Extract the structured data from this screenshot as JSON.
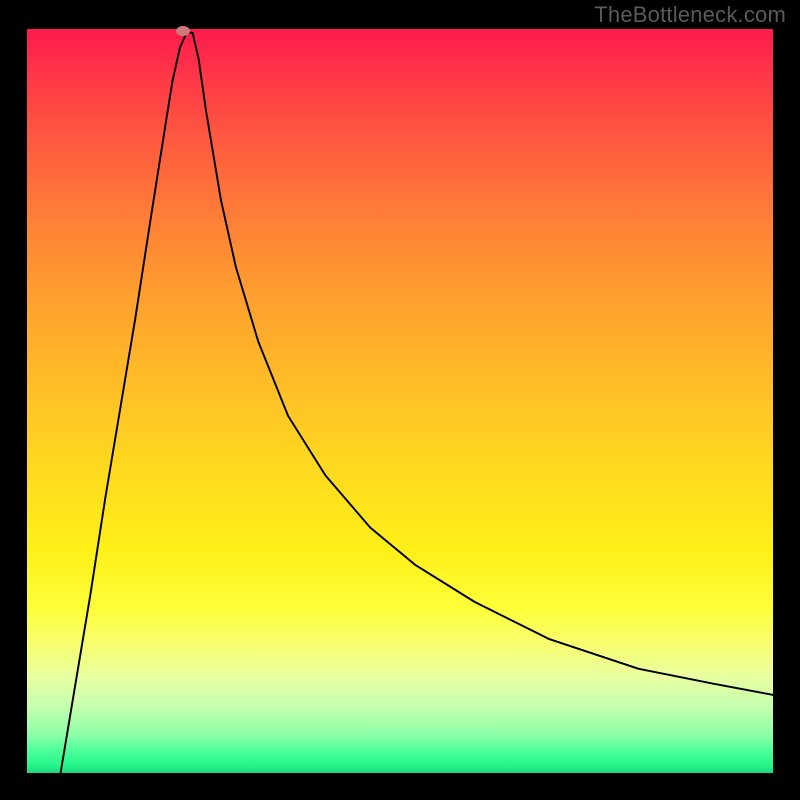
{
  "watermark": "TheBottleneck.com",
  "chart_data": {
    "type": "line",
    "title": "",
    "xlabel": "",
    "ylabel": "",
    "xlim": [
      0,
      100
    ],
    "ylim": [
      100,
      0
    ],
    "grid": false,
    "note": "Unlabeled axes; values below are approximate pixel-fraction coordinates (0–100) read from the plot area.",
    "series": [
      {
        "name": "curve",
        "x": [
          4.5,
          6.5,
          8.5,
          10.5,
          12.5,
          14.5,
          16.5,
          18.7,
          19.5,
          20.5,
          21.4,
          22.2,
          23.0,
          24.0,
          26.0,
          28.0,
          31.0,
          35.0,
          40.0,
          46.0,
          52.0,
          60.0,
          70.0,
          82.0,
          92.0,
          100.0
        ],
        "y": [
          0.0,
          12.0,
          24.0,
          37.0,
          49.0,
          61.0,
          74.0,
          88.0,
          93.0,
          97.5,
          99.5,
          99.5,
          96.0,
          89.0,
          77.0,
          68.0,
          58.0,
          48.0,
          40.0,
          33.0,
          28.0,
          23.0,
          18.0,
          14.0,
          12.0,
          10.5
        ]
      }
    ],
    "marker": {
      "x": 20.9,
      "y": 99.7
    },
    "background_gradient": {
      "direction": "vertical",
      "stops": [
        {
          "pos": 0,
          "color": "#ff1a4b"
        },
        {
          "pos": 24,
          "color": "#ff7a38"
        },
        {
          "pos": 58,
          "color": "#ffd720"
        },
        {
          "pos": 78,
          "color": "#feff3a"
        },
        {
          "pos": 95,
          "color": "#8affa8"
        },
        {
          "pos": 100,
          "color": "#1ed87e"
        }
      ]
    }
  }
}
